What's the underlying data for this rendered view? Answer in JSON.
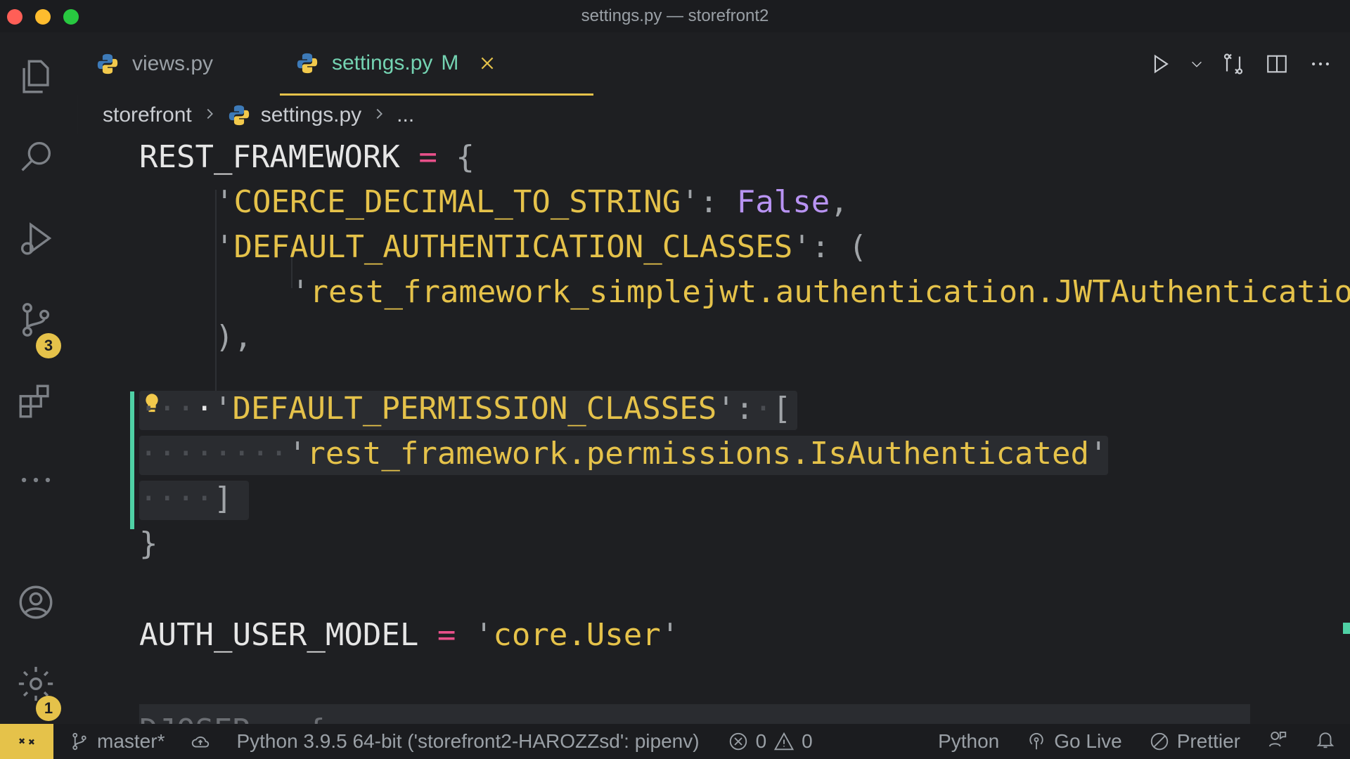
{
  "window": {
    "title": "settings.py — storefront2"
  },
  "tabs": [
    {
      "label": "views.py"
    },
    {
      "label": "settings.py",
      "modified": "M",
      "active": true
    }
  ],
  "breadcrumb": {
    "folder": "storefront",
    "file": "settings.py",
    "more": "..."
  },
  "activity_bar": {
    "source_control_badge": "3",
    "settings_badge": "1"
  },
  "code": {
    "l1_var": "REST_FRAMEWORK",
    "l1_op": "=",
    "l1_brace": "{",
    "l2_key": "COERCE_DECIMAL_TO_STRING",
    "l2_val": "False",
    "l3_key": "DEFAULT_AUTHENTICATION_CLASSES",
    "l3_paren": "(",
    "l4_str": "rest_framework_simplejwt.authentication.JWTAuthentication",
    "l5_close": "),",
    "l6_key": "DEFAULT_PERMISSION_CLASSES",
    "l6_bracket": "[",
    "l7_str": "rest_framework.permissions.IsAuthenticated",
    "l8_close": "]",
    "l9_close": "}",
    "l10_var": "AUTH_USER_MODEL",
    "l10_op": "=",
    "l10_str": "core.User",
    "l11_partial": "DJOSER = {"
  },
  "statusbar": {
    "branch": "master*",
    "interpreter": "Python 3.9.5 64-bit ('storefront2-HAROZZsd': pipenv)",
    "errors": "0",
    "warnings": "0",
    "language": "Python",
    "go_live": "Go Live",
    "prettier": "Prettier"
  },
  "colors": {
    "accent": "#e5c24a",
    "modified": "#74d3b2",
    "background": "#1e1f22"
  }
}
